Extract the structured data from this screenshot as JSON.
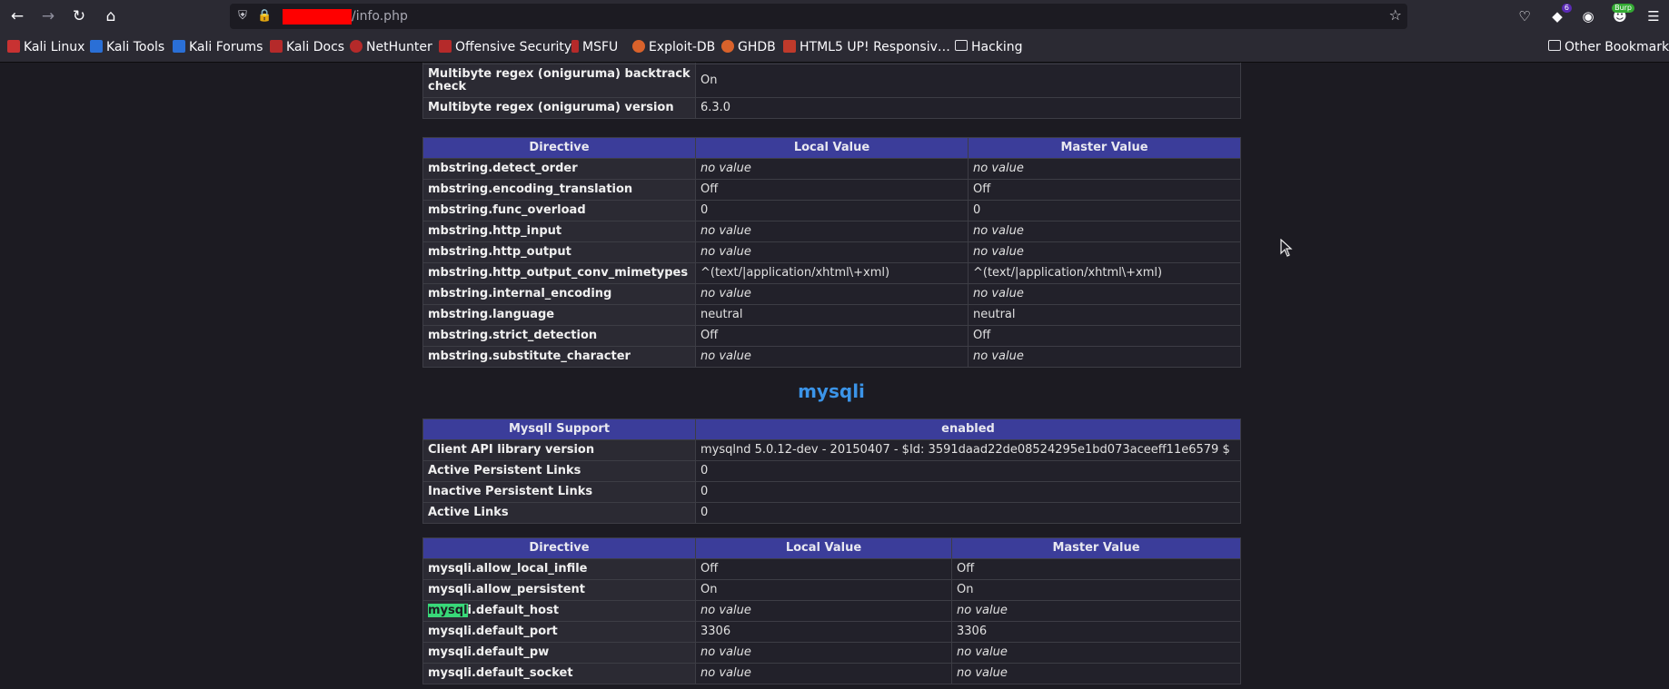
{
  "browser": {
    "url_path": "/info.php",
    "bookmarks": [
      {
        "label": "Kali Linux",
        "icon": "kali-icon"
      },
      {
        "label": "Kali Tools",
        "icon": "kali-tools-icon"
      },
      {
        "label": "Kali Forums",
        "icon": "kali-forums-icon"
      },
      {
        "label": "Kali Docs",
        "icon": "kali-docs-icon"
      },
      {
        "label": "NetHunter",
        "icon": "nethunter-icon"
      },
      {
        "label": "Offensive Security",
        "icon": "offsec-icon"
      },
      {
        "label": "MSFU",
        "icon": "msfu-icon"
      },
      {
        "label": "Exploit-DB",
        "icon": "exploit-db-icon"
      },
      {
        "label": "GHDB",
        "icon": "ghdb-icon"
      },
      {
        "label": "HTML5 UP! Responsiv…",
        "icon": "html5up-icon"
      },
      {
        "label": "Hacking",
        "icon": "folder-icon"
      }
    ],
    "other_bookmarks": "Other Bookmarks",
    "extension_badge_count": "6",
    "burp_badge": "Burp"
  },
  "mbstring_top": [
    {
      "name": "Multibyte regex (oniguruma) backtrack check",
      "value": "On"
    },
    {
      "name": "Multibyte regex (oniguruma) version",
      "value": "6.3.0"
    }
  ],
  "mbstring_directives": {
    "headers": [
      "Directive",
      "Local Value",
      "Master Value"
    ],
    "rows": [
      {
        "name": "mbstring.detect_order",
        "local": "no value",
        "master": "no value"
      },
      {
        "name": "mbstring.encoding_translation",
        "local": "Off",
        "master": "Off"
      },
      {
        "name": "mbstring.func_overload",
        "local": "0",
        "master": "0"
      },
      {
        "name": "mbstring.http_input",
        "local": "no value",
        "master": "no value"
      },
      {
        "name": "mbstring.http_output",
        "local": "no value",
        "master": "no value"
      },
      {
        "name": "mbstring.http_output_conv_mimetypes",
        "local": "^(text/|application/xhtml\\+xml)",
        "master": "^(text/|application/xhtml\\+xml)"
      },
      {
        "name": "mbstring.internal_encoding",
        "local": "no value",
        "master": "no value"
      },
      {
        "name": "mbstring.language",
        "local": "neutral",
        "master": "neutral"
      },
      {
        "name": "mbstring.strict_detection",
        "local": "Off",
        "master": "Off"
      },
      {
        "name": "mbstring.substitute_character",
        "local": "no value",
        "master": "no value"
      }
    ]
  },
  "mysqli": {
    "heading": "mysqli",
    "support_header": [
      "MysqlI Support",
      "enabled"
    ],
    "info": [
      {
        "name": "Client API library version",
        "value": "mysqlnd 5.0.12-dev - 20150407 - $Id: 3591daad22de08524295e1bd073aceeff11e6579 $"
      },
      {
        "name": "Active Persistent Links",
        "value": "0"
      },
      {
        "name": "Inactive Persistent Links",
        "value": "0"
      },
      {
        "name": "Active Links",
        "value": "0"
      }
    ],
    "headers": [
      "Directive",
      "Local Value",
      "Master Value"
    ],
    "directives": [
      {
        "name": "mysqli.allow_local_infile",
        "local": "Off",
        "master": "Off"
      },
      {
        "name": "mysqli.allow_persistent",
        "local": "On",
        "master": "On"
      },
      {
        "name_hl": "mysql",
        "name_rest": "i.default_host",
        "local": "no value",
        "master": "no value"
      },
      {
        "name": "mysqli.default_port",
        "local": "3306",
        "master": "3306"
      },
      {
        "name": "mysqli.default_pw",
        "local": "no value",
        "master": "no value"
      },
      {
        "name": "mysqli.default_socket",
        "local": "no value",
        "master": "no value"
      }
    ]
  }
}
